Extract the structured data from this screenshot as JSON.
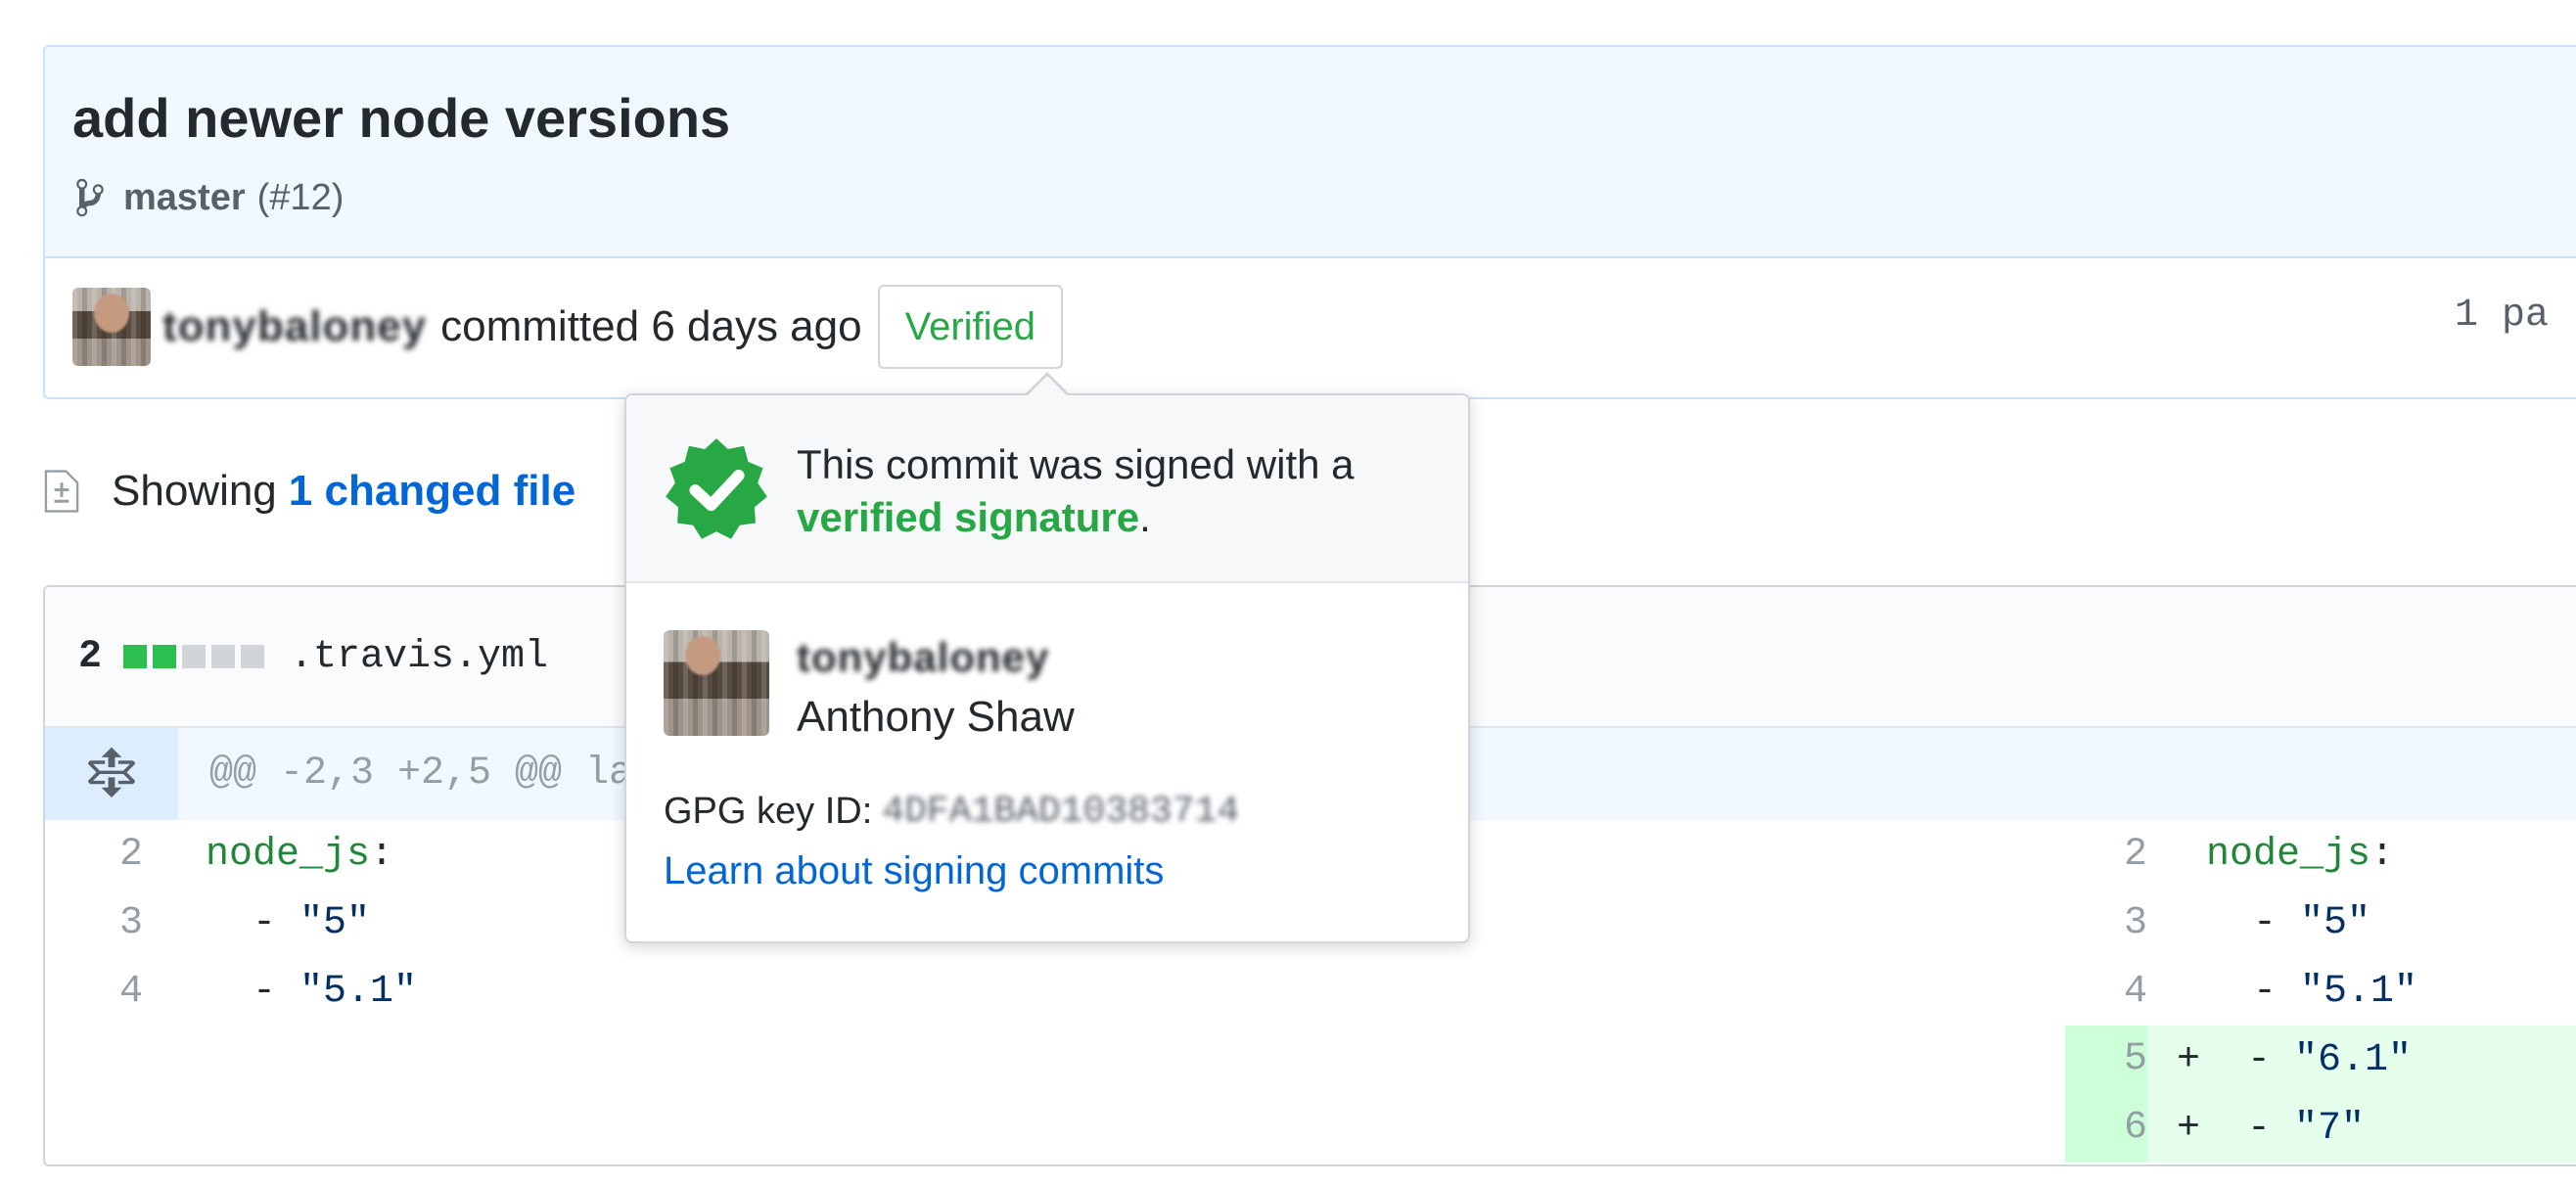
{
  "commit": {
    "title": "add newer node versions",
    "branch": "master",
    "pr_ref": "(#12)",
    "author_username": "tonybaloney",
    "committed_text": "committed 6 days ago",
    "verified_label": "Verified",
    "parent_label": "1 pa"
  },
  "summary": {
    "showing_label": "Showing",
    "changed_link": "1 changed file"
  },
  "file": {
    "diffstat_count": "2",
    "diffstat_blocks": [
      "added",
      "added",
      "neutral",
      "neutral",
      "neutral"
    ],
    "filename": ".travis.yml",
    "hunk_header": "@@ -2,3 +2,5 @@ la",
    "left_lines": [
      {
        "num": "2",
        "key": "node_js",
        "punct": ":"
      },
      {
        "num": "3",
        "prefix": "  - ",
        "value": "\"5\""
      },
      {
        "num": "4",
        "prefix": "  - ",
        "value": "\"5.1\""
      }
    ],
    "right_lines": [
      {
        "num": "2",
        "key": "node_js",
        "punct": ":"
      },
      {
        "num": "3",
        "prefix": "  - ",
        "value": "\"5\""
      },
      {
        "num": "4",
        "prefix": "  - ",
        "value": "\"5.1\""
      },
      {
        "num": "5",
        "marker": "+",
        "prefix": "  - ",
        "value": "\"6.1\""
      },
      {
        "num": "6",
        "marker": "+",
        "prefix": "  - ",
        "value": "\"7\""
      }
    ]
  },
  "popover": {
    "signed_text": "This commit was signed with a",
    "verified_signature": "verified signature",
    "period": ".",
    "signer_username": "tonybaloney",
    "signer_fullname": "Anthony Shaw",
    "gpg_label": "GPG key ID:",
    "gpg_key": "4DFA1BAD10383714",
    "learn_link": "Learn about signing commits"
  },
  "colors": {
    "verified_green": "#28a745",
    "link_blue": "#0366d6",
    "header_bg": "#f1f8ff",
    "added_bg": "#e6ffed"
  },
  "icons": {
    "branch": "git-branch-icon",
    "file_diff": "file-diff-icon",
    "expand": "unfold-icon",
    "seal": "verified-checkmark-icon"
  }
}
